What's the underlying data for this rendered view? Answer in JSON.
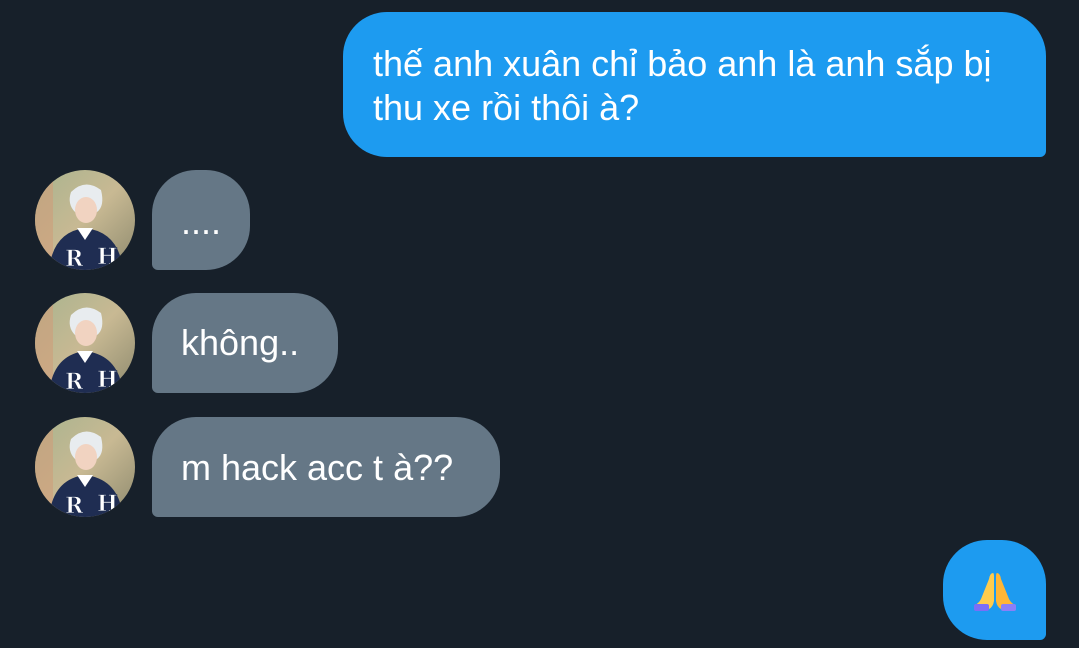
{
  "messages": [
    {
      "id": "m1",
      "from": "me",
      "text": "thế anh xuân chỉ bảo anh là anh sắp bị thu xe rồi thôi à?"
    },
    {
      "id": "m2",
      "from": "them",
      "text": "...."
    },
    {
      "id": "m3",
      "from": "them",
      "text": "không.."
    },
    {
      "id": "m4",
      "from": "them",
      "text": "m hack acc t à??"
    },
    {
      "id": "m5",
      "from": "me",
      "text": "",
      "emoji": "folded-hands-emoji"
    }
  ],
  "colors": {
    "background": "#17202a",
    "sent_bubble": "#1d9bf0",
    "received_bubble": "#657786",
    "text": "#ffffff"
  },
  "avatar": {
    "icon": "user-avatar-photo",
    "jacket_letters": "R H"
  }
}
